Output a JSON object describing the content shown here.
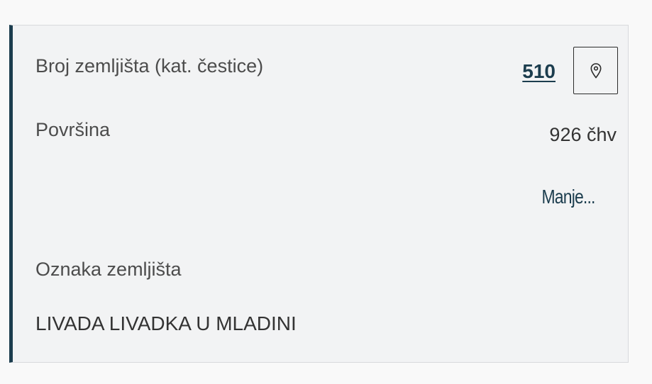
{
  "card": {
    "parcel_number_label": "Broj zemljišta (kat. čestice)",
    "parcel_number_value": "510",
    "location_icon": "map-pin-icon",
    "area_label": "Površina",
    "area_value": "926 čhv",
    "less_link": "Manje...",
    "land_designation_label": "Oznaka zemljišta",
    "land_designation_value": "LIVADA LIVADKA U MLADINI"
  },
  "colors": {
    "accent": "#1c3d4e",
    "card_background": "#f2f3f4",
    "page_background": "#f9f9f9"
  }
}
